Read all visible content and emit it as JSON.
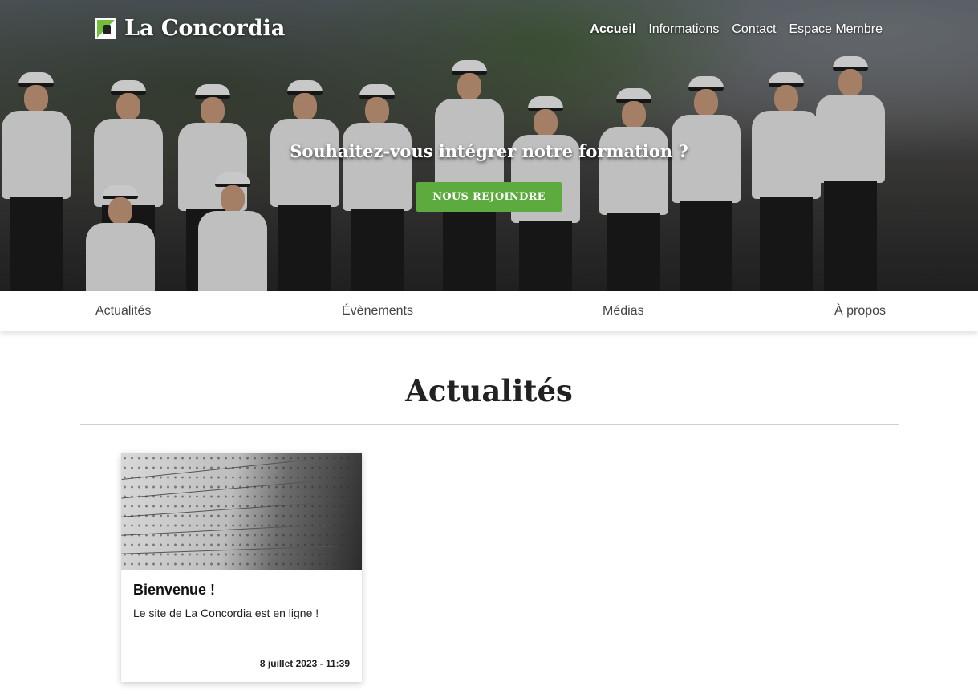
{
  "site": {
    "name": "La Concordia"
  },
  "topnav": [
    {
      "label": "Accueil",
      "active": true
    },
    {
      "label": "Informations",
      "active": false
    },
    {
      "label": "Contact",
      "active": false
    },
    {
      "label": "Espace Membre",
      "active": false
    }
  ],
  "hero": {
    "heading": "Souhaitez-vous intégrer notre formation ?",
    "button_label": "NOUS REJOINDRE"
  },
  "subnav": [
    {
      "label": "Actualités"
    },
    {
      "label": "Évènements"
    },
    {
      "label": "Médias"
    },
    {
      "label": "À propos"
    }
  ],
  "news": {
    "title": "Actualités",
    "items": [
      {
        "title": "Bienvenue !",
        "text": "Le site de La Concordia est en ligne !",
        "date": "8 juillet 2023 - 11:39"
      }
    ]
  },
  "colors": {
    "accent_green": "#5dab3e"
  },
  "icons": {
    "logo": "coat-of-arms-icon"
  }
}
